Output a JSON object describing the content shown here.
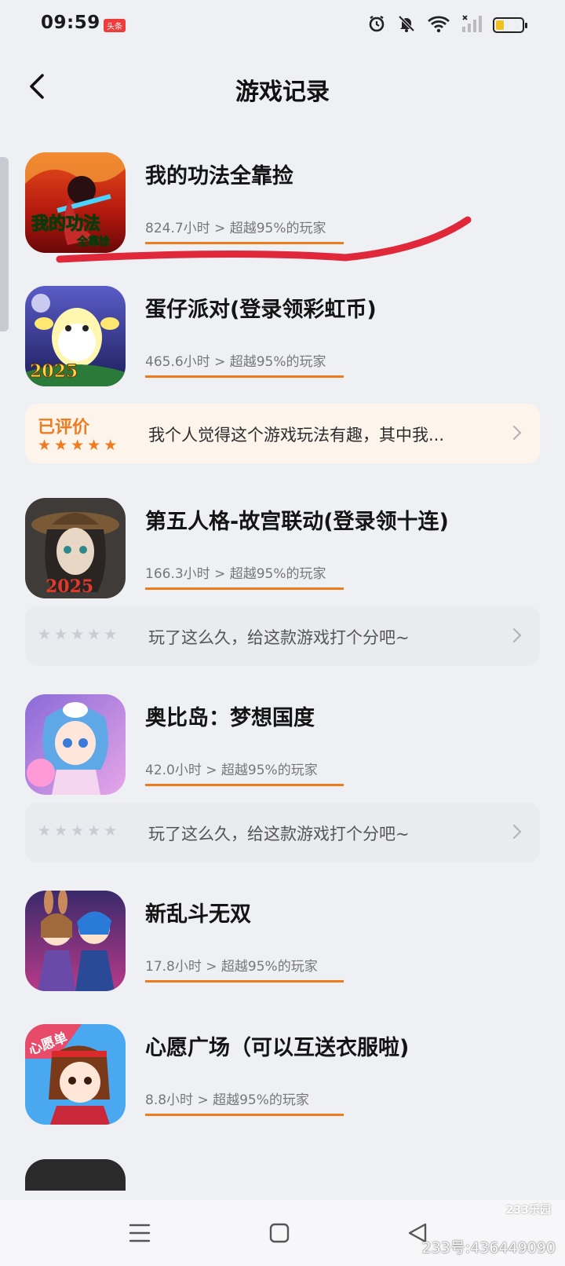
{
  "status_bar": {
    "time": "09:59",
    "news_tag": "头条",
    "battery_level": 0.3
  },
  "header": {
    "back_icon": "chevron-left-icon",
    "title": "游戏记录"
  },
  "games": [
    {
      "name": "我的功法全靠捡",
      "stat": "824.7小时 > 超越95%的玩家",
      "icon_text": "我的功法",
      "icon_subtext": "全靠捡"
    },
    {
      "name": "蛋仔派对(登录领彩虹币)",
      "stat": "465.6小时 > 超越95%的玩家",
      "icon_text": "2025",
      "icon_subtext": ""
    },
    {
      "name": "第五人格-故宫联动(登录领十连)",
      "stat": "166.3小时 > 超越95%的玩家",
      "icon_text": "2025",
      "icon_subtext": ""
    },
    {
      "name": "奥比岛：梦想国度",
      "stat": "42.0小时 > 超越95%的玩家",
      "icon_text": "",
      "icon_subtext": ""
    },
    {
      "name": "新乱斗无双",
      "stat": "17.8小时 > 超越95%的玩家",
      "icon_text": "",
      "icon_subtext": ""
    },
    {
      "name": "心愿广场（可以互送衣服啦)",
      "stat": "8.8小时 > 超越95%的玩家",
      "icon_text": "心愿单",
      "icon_subtext": ""
    }
  ],
  "reviews": [
    {
      "state": "rated",
      "label": "已评价",
      "stars": 5,
      "text": "我个人觉得这个游戏玩法有趣，其中我..."
    },
    {
      "state": "unrated",
      "label": "",
      "stars": 0,
      "text": "玩了这么久，给这款游戏打个分吧~"
    },
    {
      "state": "unrated",
      "label": "",
      "stars": 0,
      "text": "玩了这么久，给这款游戏打个分吧~"
    }
  ],
  "nav": {
    "menu_icon": "menu-icon",
    "home_icon": "square-home-icon",
    "back_icon": "triangle-back-icon"
  },
  "watermark": {
    "badge": "233乐园",
    "id": "233号:436449090"
  },
  "colors": {
    "accent": "#f07b1e",
    "annotation": "#e0283a",
    "background": "#eef0f4"
  }
}
